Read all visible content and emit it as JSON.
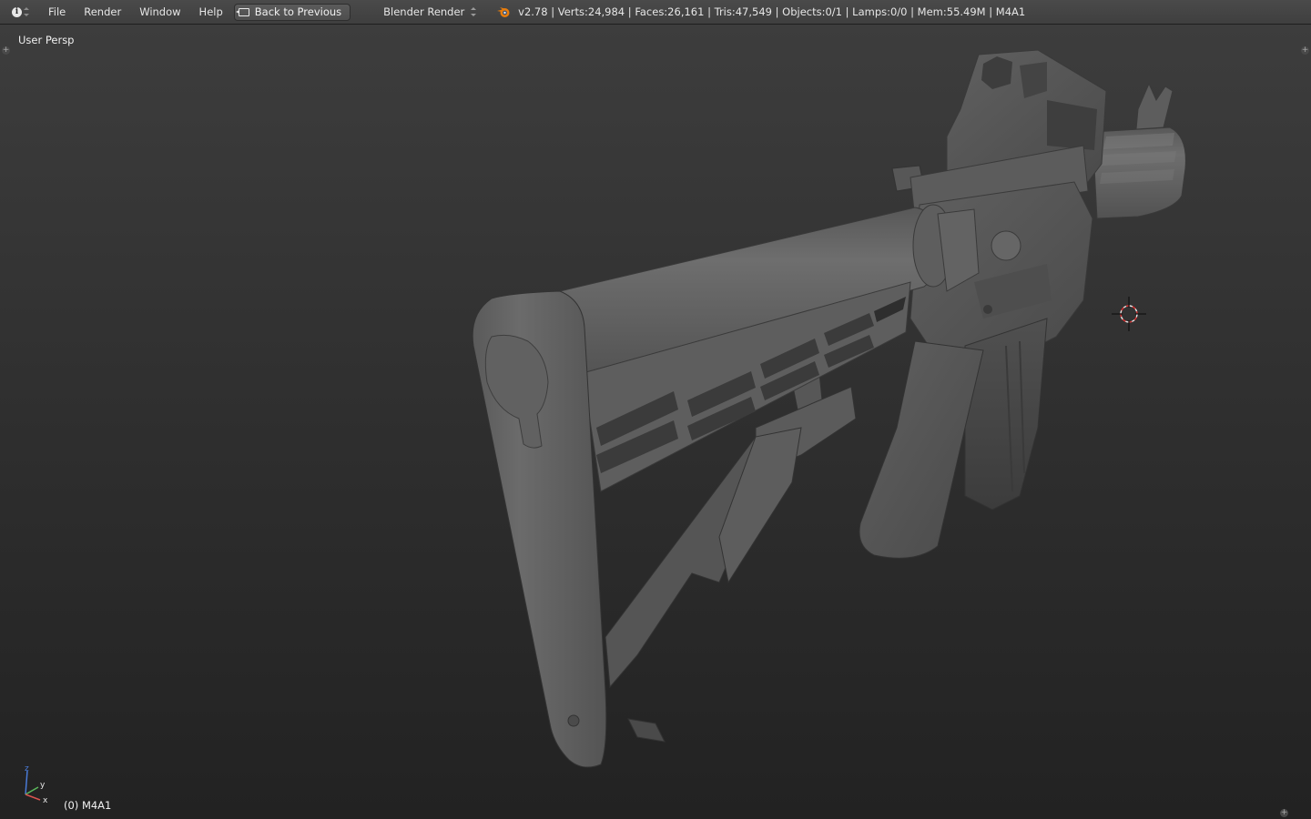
{
  "header": {
    "menu": [
      "File",
      "Render",
      "Window",
      "Help"
    ],
    "back_button": "Back to Previous",
    "render_engine": "Blender Render",
    "stats": "v2.78 | Verts:24,984 | Faces:26,161 | Tris:47,549 | Objects:0/1 | Lamps:0/0 | Mem:55.49M | M4A1"
  },
  "viewport": {
    "view_name": "User Persp",
    "object_label": "(0) M4A1",
    "axes": {
      "x": "x",
      "y": "y",
      "z": "z"
    }
  },
  "colors": {
    "header_bg": "#434343",
    "viewport_top": "#3d3d3d",
    "viewport_bottom": "#222222",
    "mesh": "#6a6a6a",
    "axis_x": "#d9534f",
    "axis_y": "#5cb85c",
    "axis_z": "#4a7bd8",
    "blender_orange": "#e87d0d"
  },
  "icons": {
    "editor_type": "info-icon",
    "back": "back-to-previous-icon",
    "engine": "blender-logo-icon",
    "cursor": "3d-cursor-icon"
  }
}
